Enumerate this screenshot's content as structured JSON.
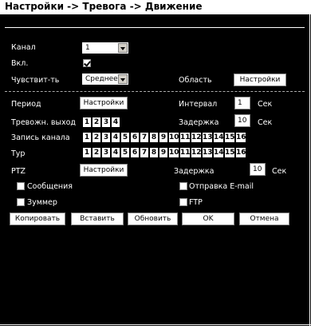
{
  "title": "Настройки -> Тревога -> Движение",
  "channel": {
    "label": "Канал",
    "value": "1"
  },
  "enable": {
    "label": "Вкл.",
    "checked": true
  },
  "sensitivity": {
    "label": "Чувствит-ть",
    "value": "Среднее"
  },
  "area": {
    "label": "Область",
    "button": "Настройки"
  },
  "period": {
    "label": "Период",
    "button": "Настройки"
  },
  "interval": {
    "label": "Интервал",
    "value": "1",
    "unit": "Сек"
  },
  "alarm_out": {
    "label": "Тревожн. выход",
    "cells": [
      "1",
      "2",
      "3",
      "4"
    ]
  },
  "delay1": {
    "label": "Задержка",
    "value": "10",
    "unit": "Сек"
  },
  "record": {
    "label": "Запись канала",
    "cells": [
      "1",
      "2",
      "3",
      "4",
      "5",
      "6",
      "7",
      "8",
      "9",
      "10",
      "11",
      "12",
      "13",
      "14",
      "15",
      "16"
    ]
  },
  "tour": {
    "label": "Тур",
    "cells": [
      "1",
      "2",
      "3",
      "4",
      "5",
      "6",
      "7",
      "8",
      "9",
      "10",
      "11",
      "12",
      "13",
      "14",
      "15",
      "16"
    ]
  },
  "ptz": {
    "label": "PTZ",
    "button": "Настройки"
  },
  "delay2": {
    "label": "Задержка",
    "value": "10",
    "unit": "Сек"
  },
  "messages": {
    "label": "Сообщения",
    "checked": false
  },
  "email": {
    "label": "Отправка E-mail",
    "checked": false
  },
  "buzzer": {
    "label": "Зуммер",
    "checked": false
  },
  "ftp": {
    "label": "FTP",
    "checked": false
  },
  "buttons": {
    "copy": "Копировать",
    "paste": "Вставить",
    "refresh": "Обновить",
    "ok": "OK",
    "cancel": "Отмена"
  }
}
